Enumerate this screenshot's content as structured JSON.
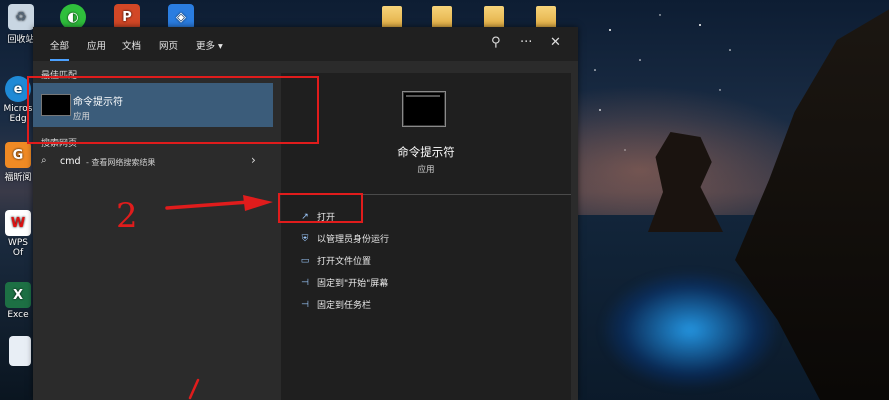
{
  "desktop": {
    "icons": [
      {
        "name": "recycle-bin",
        "label": "回收站"
      },
      {
        "name": "edge",
        "label": "Micros Edg"
      },
      {
        "name": "foxit",
        "label": "福昕阅"
      },
      {
        "name": "wps",
        "label": "WPS Of"
      },
      {
        "name": "excel",
        "label": "Exce"
      }
    ]
  },
  "start_menu": {
    "tabs": [
      "全部",
      "应用",
      "文档",
      "网页",
      "更多 ▾"
    ],
    "top_icons": {
      "feedback": "⚲",
      "more": "···",
      "close": "✕"
    },
    "left": {
      "best_match_title": "最佳匹配",
      "best_match": {
        "name": "命令提示符",
        "type": "应用"
      },
      "web_search_title": "搜索网页",
      "web_result": {
        "query": "cmd",
        "suffix": " - 查看网络搜索结果",
        "chevron": "›"
      }
    },
    "right": {
      "app_name": "命令提示符",
      "app_type": "应用",
      "actions": [
        {
          "icon": "open-icon",
          "glyph": "↗",
          "label": "打开"
        },
        {
          "icon": "shield-icon",
          "glyph": "⛨",
          "label": "以管理员身份运行"
        },
        {
          "icon": "folder-icon",
          "glyph": "▭",
          "label": "打开文件位置"
        },
        {
          "icon": "pin-start-icon",
          "glyph": "⊣",
          "label": "固定到\"开始\"屏幕"
        },
        {
          "icon": "pin-taskbar-icon",
          "glyph": "⊣",
          "label": "固定到任务栏"
        }
      ]
    }
  },
  "annotations": {
    "step2": "2",
    "annotation_color": "#e01c1c"
  }
}
